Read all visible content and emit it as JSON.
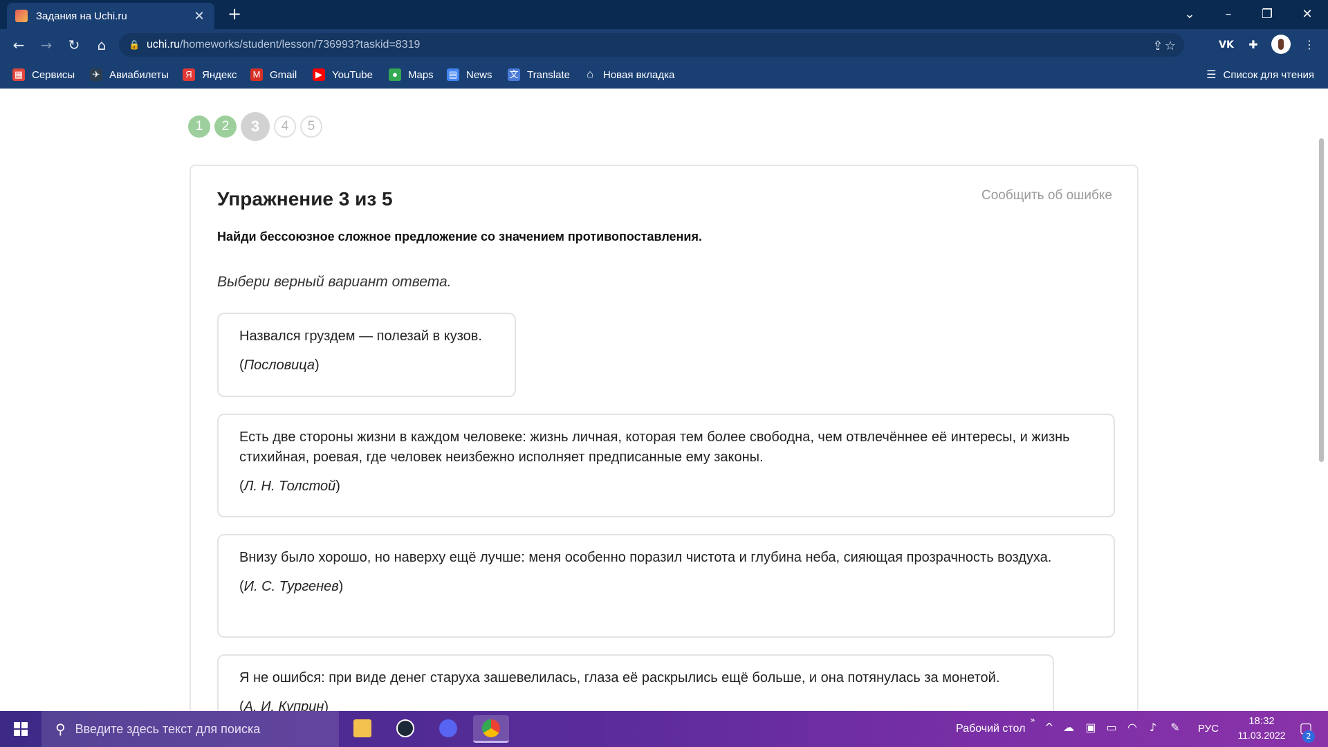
{
  "browser": {
    "tab_title": "Задания на Uchi.ru",
    "url_domain": "uchi.ru",
    "url_path": "/homeworks/student/lesson/736993?taskid=8319",
    "bookmarks": [
      "Сервисы",
      "Авиабилеты",
      "Яндекс",
      "Gmail",
      "YouTube",
      "Maps",
      "News",
      "Translate",
      "Новая вкладка"
    ],
    "reading_list": "Список для чтения",
    "ext_vk": "VK"
  },
  "steps": [
    "1",
    "2",
    "3",
    "4",
    "5"
  ],
  "steps_status": [
    "done",
    "done",
    "current",
    "todo",
    "todo"
  ],
  "exercise": {
    "title": "Упражнение 3 из 5",
    "report_link": "Сообщить об ошибке",
    "task": "Найди бессоюзное сложное предложение со значением противопоставления.",
    "hint": "Выбери верный вариант ответа.",
    "options": [
      {
        "text": "Назвался груздем — полезай в кузов.",
        "author": "Пословица"
      },
      {
        "text": "Есть две стороны жизни в каждом человеке: жизнь личная, которая тем более свободна, чем отвлечённее её интересы, и жизнь стихийная, роевая, где человек неизбежно исполняет предписанные ему законы.",
        "author": "Л. Н. Толстой"
      },
      {
        "text": "Внизу было хорошо, но наверху ещё лучше: меня особенно поразил чистота и глубина неба, сияющая прозрачность воздуха.",
        "author": "И. С. Тургенев"
      },
      {
        "text": "Я не ошибся: при виде денег старуха зашевелилась, глаза её раскрылись ещё больше, и она потянулась за монетой.",
        "author": "А. И. Куприн"
      }
    ]
  },
  "taskbar": {
    "search_placeholder": "Введите здесь текст для поиска",
    "desktop_label": "Рабочий стол",
    "lang": "РУС",
    "time": "18:32",
    "date": "11.03.2022",
    "notif_count": "2"
  },
  "colors": {
    "titlebar": "#0b2a52",
    "toolbar": "#1a3f73",
    "step_done": "#9ccf9c",
    "step_current": "#d2d2d2"
  }
}
